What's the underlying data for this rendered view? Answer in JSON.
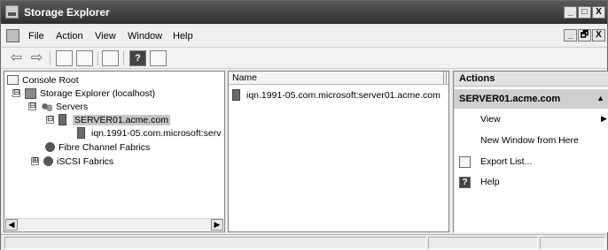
{
  "window": {
    "title": "Storage Explorer",
    "buttons": [
      "_",
      "□",
      "X"
    ],
    "child_buttons": [
      "_",
      "🗗",
      "X"
    ]
  },
  "menu": {
    "items": [
      "File",
      "Action",
      "View",
      "Window",
      "Help"
    ]
  },
  "toolbar": {
    "icons": [
      "back-arrow-icon",
      "forward-arrow-icon",
      "up-level-icon",
      "show-hide-tree-icon",
      "export-list-icon",
      "help-icon",
      "show-hide-action-pane-icon"
    ],
    "help_glyph": "?"
  },
  "tree": {
    "items": [
      {
        "label": "Console Root"
      },
      {
        "label": "Storage Explorer (localhost)",
        "expander": "⊟"
      },
      {
        "label": "Servers",
        "expander": "⊟"
      },
      {
        "label": "SERVER01.acme.com",
        "expander": "⊟",
        "selected": true
      },
      {
        "label": "iqn.1991-05.com.microsoft:serv"
      },
      {
        "label": "Fibre Channel Fabrics"
      },
      {
        "label": "iSCSI Fabrics",
        "expander": "⊞"
      }
    ]
  },
  "list": {
    "column_header": "Name",
    "rows": [
      {
        "label": "iqn.1991-05.com.microsoft:server01.acme.com"
      }
    ]
  },
  "actions": {
    "header": "Actions",
    "section": "SERVER01.acme.com",
    "items": [
      {
        "label": "View",
        "submenu": true
      },
      {
        "label": "New Window from Here"
      },
      {
        "label": "Export List..."
      },
      {
        "label": "Help"
      }
    ],
    "help_glyph": "?"
  }
}
